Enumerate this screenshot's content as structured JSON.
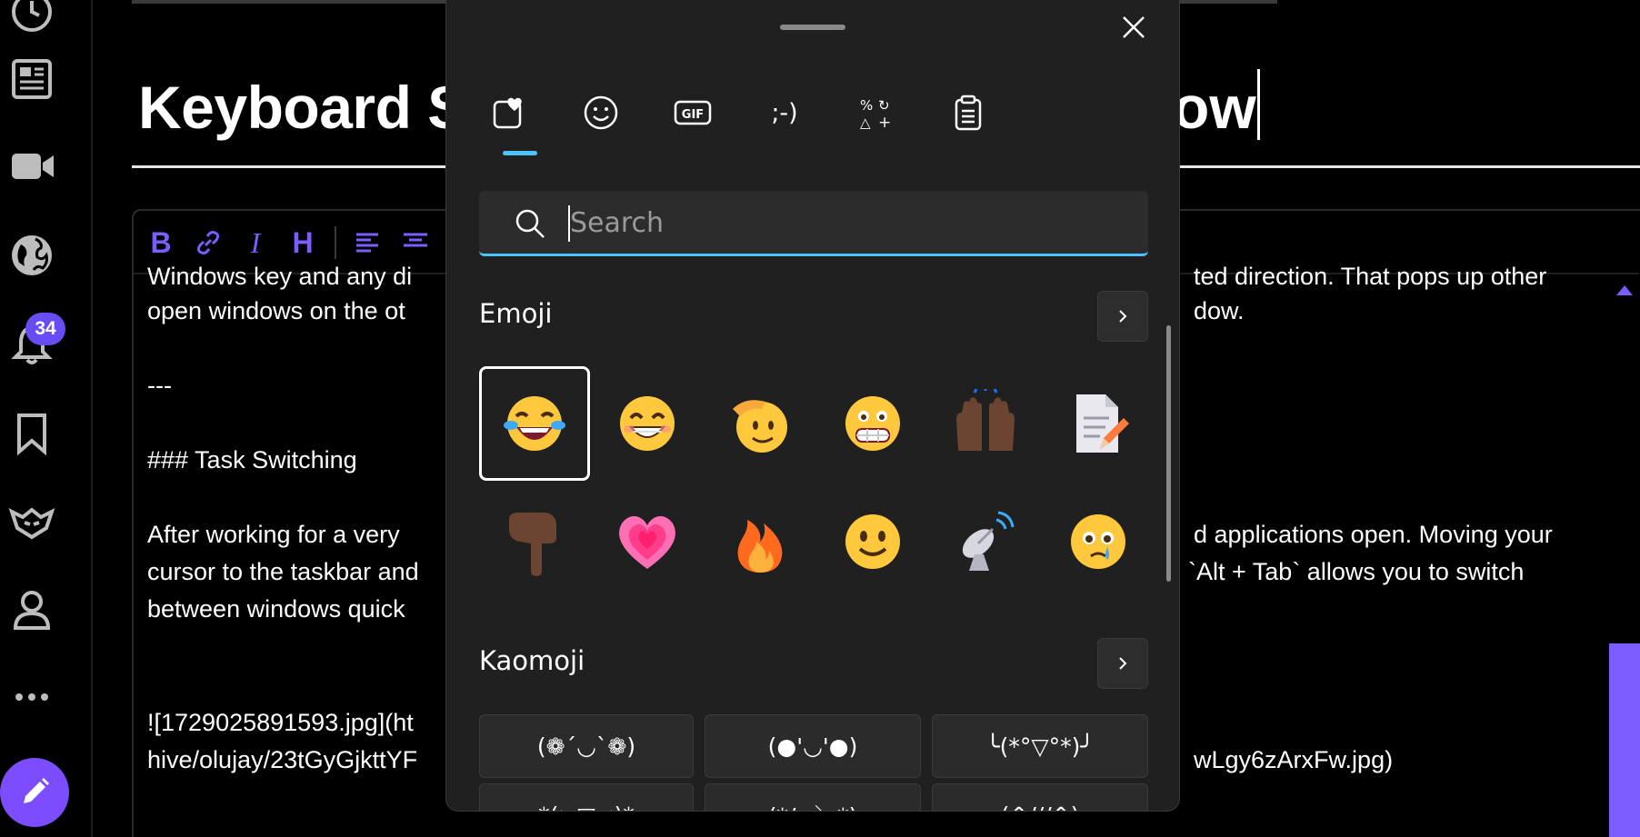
{
  "sidebar": {
    "items": [
      {
        "name": "sidebar-item-history",
        "icon": "clock-icon"
      },
      {
        "name": "sidebar-item-news",
        "icon": "newspaper-icon"
      },
      {
        "name": "sidebar-item-videos",
        "icon": "video-camera-icon"
      },
      {
        "name": "sidebar-item-explore",
        "icon": "globe-icon"
      },
      {
        "name": "sidebar-item-notifications",
        "icon": "bell-icon"
      },
      {
        "name": "sidebar-item-bookmarks",
        "icon": "bookmark-icon"
      },
      {
        "name": "sidebar-item-communities",
        "icon": "wolf-icon"
      },
      {
        "name": "sidebar-item-profile",
        "icon": "person-icon"
      },
      {
        "name": "sidebar-item-more",
        "icon": "more-icon"
      }
    ],
    "notification_count": "34",
    "accent": "#7b4dff"
  },
  "editor": {
    "title_visible_left": "Keyboard S",
    "title_visible_right": "ow",
    "toolbar": {
      "bold": "B",
      "italic": "I",
      "heading": "H"
    },
    "lines": [
      {
        "left": "Windows key and any di",
        "right": "ted direction. That pops up other"
      },
      {
        "left": "open windows on the ot",
        "right": "dow."
      },
      {
        "left": "---",
        "right": ""
      },
      {
        "left": "### Task Switching",
        "right": ""
      },
      {
        "left": "After working for a very",
        "right": "d applications open. Moving your"
      },
      {
        "left": "cursor to the taskbar and",
        "right": "`Alt + Tab` allows you to switch"
      },
      {
        "left": "between windows quick",
        "right": ""
      },
      {
        "left": "![1729025891593.jpg](ht",
        "right": ""
      },
      {
        "left": "hive/olujay/23tGyGjkttYF",
        "right": "wLgy6zArxFw.jpg)"
      }
    ]
  },
  "emoji_panel": {
    "tabs": [
      {
        "name": "tab-favorites",
        "icon": "heart-favorites-icon"
      },
      {
        "name": "tab-emoji",
        "icon": "smiley-icon"
      },
      {
        "name": "tab-gif",
        "icon": "gif-icon"
      },
      {
        "name": "tab-kaomoji",
        "label": ";-)"
      },
      {
        "name": "tab-symbols",
        "icon": "symbols-icon"
      },
      {
        "name": "tab-clipboard",
        "icon": "clipboard-icon"
      }
    ],
    "search_placeholder": "Search",
    "emoji_section_label": "Emoji",
    "kaomoji_section_label": "Kaomoji",
    "emojis": [
      "face-with-tears-of-joy",
      "beaming-face-with-smiling-eyes",
      "saluting-face",
      "grimacing-face",
      "raising-hands",
      "memo",
      "backhand-index-pointing-down",
      "growing-heart",
      "fire",
      "slightly-smiling-face",
      "satellite-antenna",
      "face-holding-back-tears"
    ],
    "kaomoji": [
      "(❁´◡`❁)",
      "(●'◡'●)",
      "╰(*°▽°*)╯",
      "*(>▽<)*",
      "(*/ω＼*)",
      "(^///^)"
    ],
    "accent": "#4cc2ff"
  }
}
